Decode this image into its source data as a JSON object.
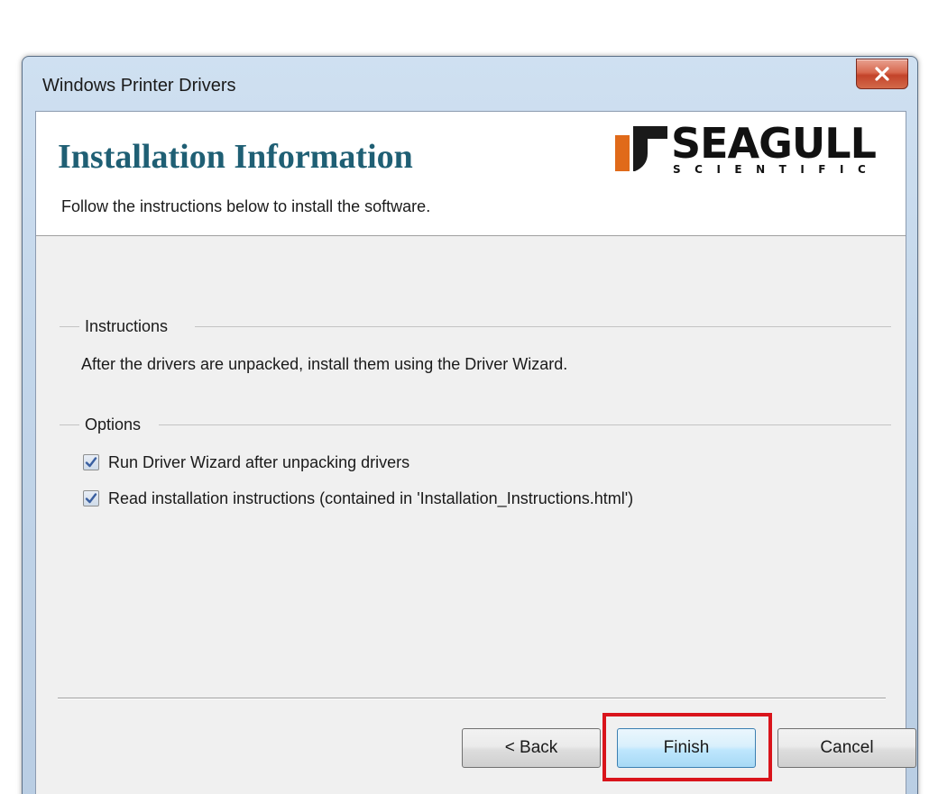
{
  "window": {
    "title": "Windows Printer Drivers"
  },
  "header": {
    "title": "Installation Information",
    "subtitle": "Follow the instructions below to install the software.",
    "logo": {
      "word": "SEAGULL",
      "sub": "SCIENTIFIC"
    }
  },
  "instructions": {
    "label": "Instructions",
    "text": "After the drivers are unpacked, install them using the Driver Wizard."
  },
  "options": {
    "label": "Options",
    "items": [
      {
        "label": "Run Driver Wizard after unpacking drivers",
        "checked": true
      },
      {
        "label": "Read installation instructions (contained in 'Installation_Instructions.html')",
        "checked": true
      }
    ]
  },
  "buttons": {
    "back": "< Back",
    "finish": "Finish",
    "cancel": "Cancel"
  },
  "colors": {
    "header_title": "#1f5f74",
    "highlight": "#d9141b",
    "logo_accent": "#e06a1a"
  },
  "icons": {
    "close": "close-icon",
    "checkbox": "checkmark-icon",
    "logo": "seagull-logo-mark"
  }
}
